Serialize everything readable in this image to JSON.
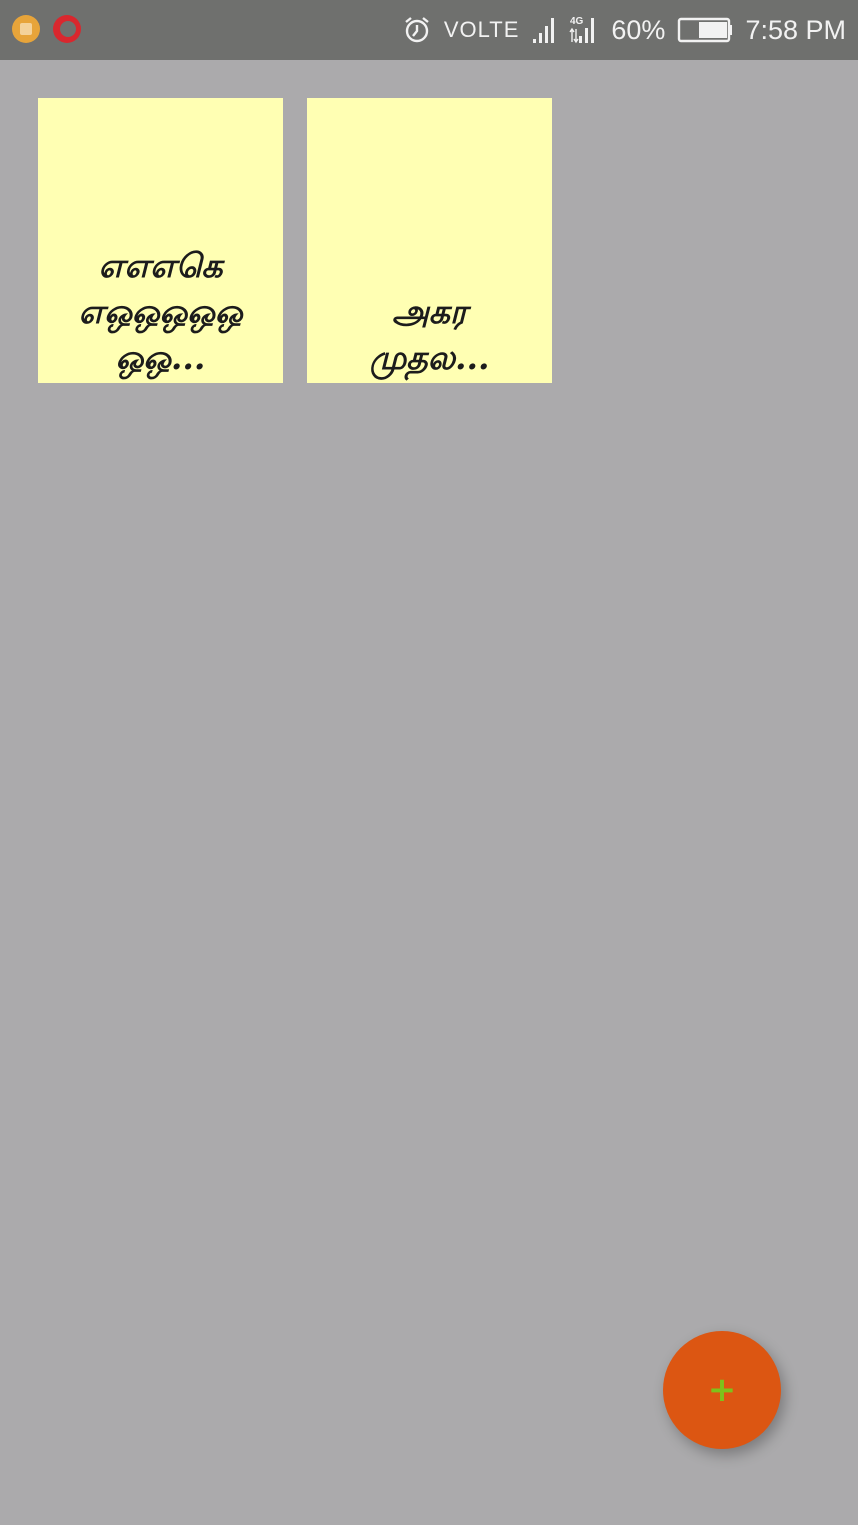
{
  "status_bar": {
    "network_label": "VOLTE",
    "data_type": "4G",
    "battery_percent": "60%",
    "time": "7:58 PM",
    "battery_level": 0.6,
    "icons": [
      "notification-app-icon",
      "opera-mini-icon",
      "alarm-icon",
      "signal-icon",
      "data-signal-icon",
      "battery-icon"
    ]
  },
  "notes": [
    {
      "text": "எஎஎகெ\nஎஒஒஒஒஒ\nஒஒ..."
    },
    {
      "text": "அகர\nமுதல..."
    }
  ],
  "fab": {
    "label": "+",
    "icon": "add-icon",
    "color": "#dc5612",
    "icon_color": "#7ec21b"
  },
  "colors": {
    "background": "#abaaac",
    "status_bar": "#6f706e",
    "note_card": "#ffffb3"
  }
}
